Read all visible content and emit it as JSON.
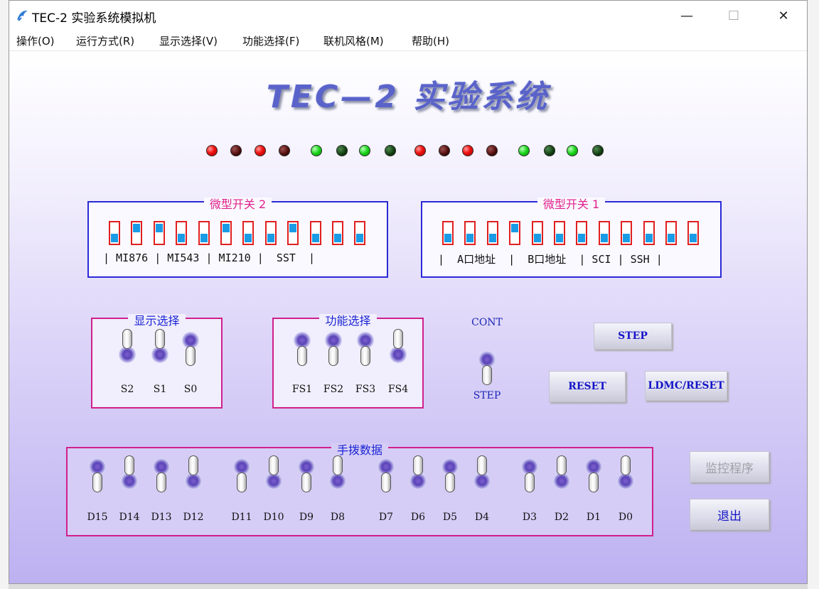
{
  "window": {
    "title": "TEC-2 实验系统模拟机",
    "minimize_glyph": "—",
    "maximize_glyph": "☐",
    "close_glyph": "✕"
  },
  "menu": [
    {
      "label": "操作(O)"
    },
    {
      "label": "运行方式(R)"
    },
    {
      "label": "显示选择(V)"
    },
    {
      "label": "功能选择(F)"
    },
    {
      "label": "联机风格(M)"
    },
    {
      "label": "帮助(H)"
    }
  ],
  "heading": "TEC—2 实验系统",
  "leds": [
    "red-on",
    "red-off",
    "red-on",
    "red-off",
    "green-on",
    "green-off",
    "green-on",
    "green-off",
    "red-on",
    "red-off",
    "red-on",
    "red-off",
    "green-on",
    "green-off",
    "green-on",
    "green-off"
  ],
  "micro_switch_2": {
    "title": "微型开关 2",
    "states": [
      "down",
      "up",
      "up",
      "down",
      "down",
      "up",
      "down",
      "down",
      "up",
      "down",
      "down",
      "down"
    ],
    "label_line": "| MI876 | MI543 | MI210 |  SST  |"
  },
  "micro_switch_1": {
    "title": "微型开关 1",
    "states": [
      "down",
      "down",
      "down",
      "up",
      "down",
      "down",
      "down",
      "down",
      "down",
      "down",
      "down",
      "down"
    ],
    "label_line": "|  A口地址  |  B口地址  | SCI | SSH |"
  },
  "display_select": {
    "title": "显示选择",
    "switches": [
      {
        "label": "S2",
        "state": "up"
      },
      {
        "label": "S1",
        "state": "up"
      },
      {
        "label": "S0",
        "state": "down"
      }
    ]
  },
  "function_select": {
    "title": "功能选择",
    "switches": [
      {
        "label": "FS1",
        "state": "down"
      },
      {
        "label": "FS2",
        "state": "down"
      },
      {
        "label": "FS3",
        "state": "down"
      },
      {
        "label": "FS4",
        "state": "up"
      }
    ]
  },
  "run_mode": {
    "top_label": "CONT",
    "bottom_label": "STEP",
    "state": "down"
  },
  "buttons": {
    "step": "STEP",
    "reset": "RESET",
    "ldmc_reset": "LDMC/RESET",
    "monitor": "监控程序",
    "exit": "退出"
  },
  "hand_data": {
    "title": "手拨数据",
    "switches": [
      {
        "label": "D15",
        "state": "down"
      },
      {
        "label": "D14",
        "state": "up"
      },
      {
        "label": "D13",
        "state": "down"
      },
      {
        "label": "D12",
        "state": "up"
      },
      {
        "label": "D11",
        "state": "down"
      },
      {
        "label": "D10",
        "state": "up"
      },
      {
        "label": "D9",
        "state": "down"
      },
      {
        "label": "D8",
        "state": "up"
      },
      {
        "label": "D7",
        "state": "down"
      },
      {
        "label": "D6",
        "state": "up"
      },
      {
        "label": "D5",
        "state": "down"
      },
      {
        "label": "D4",
        "state": "up"
      },
      {
        "label": "D3",
        "state": "down"
      },
      {
        "label": "D2",
        "state": "up"
      },
      {
        "label": "D1",
        "state": "down"
      },
      {
        "label": "D0",
        "state": "up"
      }
    ]
  },
  "colors": {
    "group_blue": "#2a2ad6",
    "group_pink": "#d0208c",
    "legend_pink": "#e0208c",
    "legend_blue": "#1a24d4",
    "dip_border": "#e02020",
    "dip_knob": "#1a9be6"
  }
}
